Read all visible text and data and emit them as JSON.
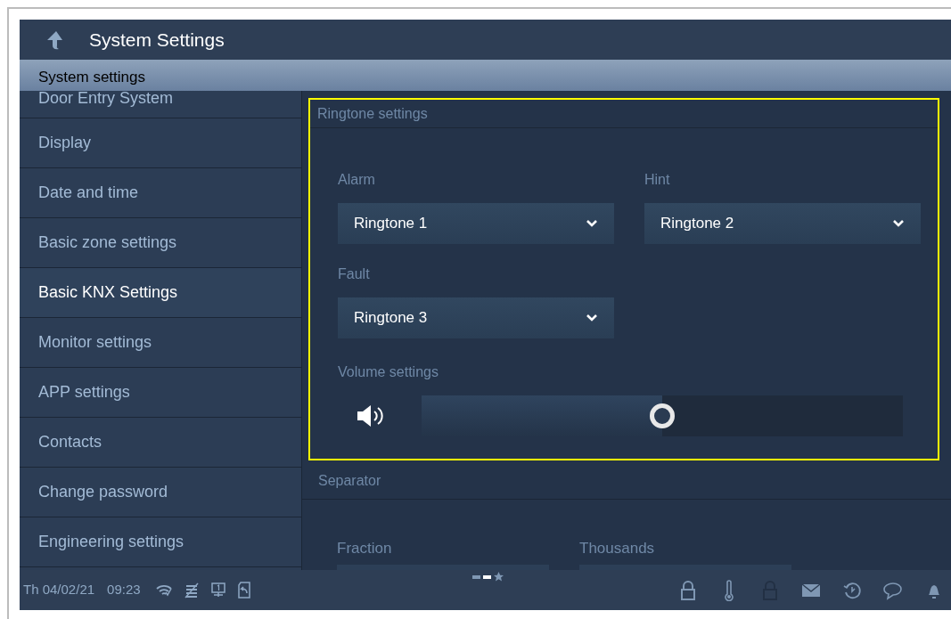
{
  "header": {
    "title": "System Settings"
  },
  "section_bar": {
    "title": "System settings"
  },
  "sidebar": {
    "items": [
      {
        "label": "Door Entry System",
        "selected": false
      },
      {
        "label": "Display",
        "selected": false
      },
      {
        "label": "Date and time",
        "selected": false
      },
      {
        "label": "Basic zone settings",
        "selected": false
      },
      {
        "label": "Basic KNX Settings",
        "selected": true
      },
      {
        "label": "Monitor settings",
        "selected": false
      },
      {
        "label": "APP settings",
        "selected": false
      },
      {
        "label": "Contacts",
        "selected": false
      },
      {
        "label": "Change password",
        "selected": false
      },
      {
        "label": "Engineering settings",
        "selected": false
      }
    ]
  },
  "ringtone_settings": {
    "title": "Ringtone settings",
    "dropdowns": [
      {
        "label": "Alarm",
        "value": "Ringtone 1"
      },
      {
        "label": "Hint",
        "value": "Ringtone 2"
      },
      {
        "label": "Fault",
        "value": "Ringtone 3"
      }
    ],
    "volume": {
      "label": "Volume settings",
      "level": 0.5
    }
  },
  "separator": {
    "title": "Separator",
    "fields": [
      {
        "label": "Fraction"
      },
      {
        "label": "Thousands"
      }
    ]
  },
  "page_indicator": [
    {
      "kind": "dash",
      "selected": false
    },
    {
      "kind": "dash",
      "selected": true
    },
    {
      "kind": "star",
      "selected": false
    }
  ],
  "status_bar": {
    "date": "Th 04/02/21",
    "time": "09:23",
    "left_icons": [
      {
        "kind": "wifi"
      },
      {
        "kind": "mute"
      },
      {
        "kind": "monitor"
      },
      {
        "kind": "card"
      }
    ],
    "right_icons": [
      {
        "kind": "lock",
        "dimmed": false
      },
      {
        "kind": "thermometer",
        "dimmed": false
      },
      {
        "kind": "lock",
        "dimmed": true
      },
      {
        "kind": "mail",
        "dimmed": false
      },
      {
        "kind": "history",
        "dimmed": false
      },
      {
        "kind": "chat",
        "dimmed": false
      },
      {
        "kind": "bell",
        "dimmed": false
      }
    ]
  }
}
